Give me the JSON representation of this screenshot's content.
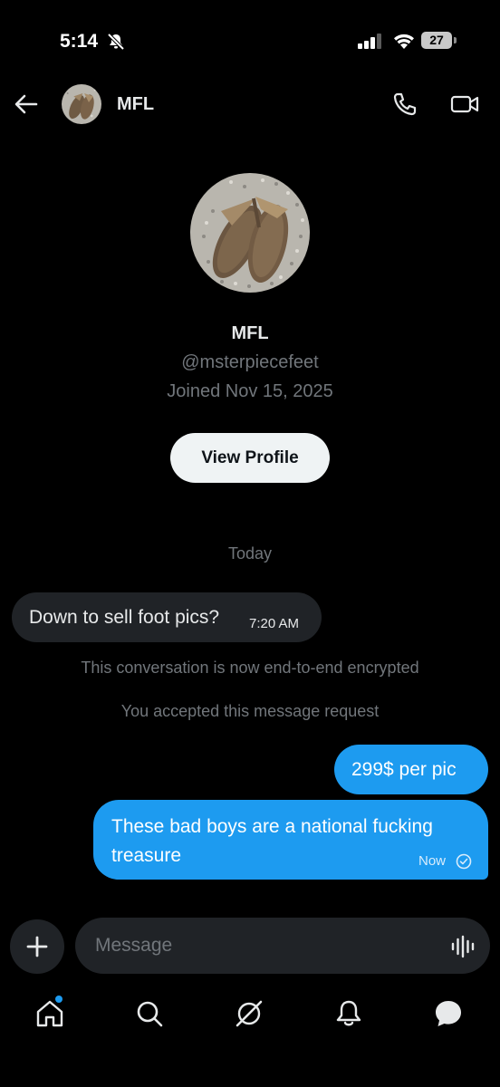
{
  "status_bar": {
    "time": "5:14",
    "battery": "27"
  },
  "header": {
    "name": "MFL"
  },
  "profile": {
    "name": "MFL",
    "handle": "@msterpiecefeet",
    "joined": "Joined Nov 15, 2025",
    "view_profile_label": "View Profile"
  },
  "conversation": {
    "date_label": "Today",
    "incoming": {
      "text": "Down to sell foot pics?",
      "time": "7:20 AM"
    },
    "system_messages": [
      "This conversation is now end-to-end encrypted",
      "You accepted this message request"
    ],
    "outgoing": [
      {
        "text": "299$ per pic"
      },
      {
        "text": "These bad boys are a national fucking treasure",
        "time": "Now"
      }
    ]
  },
  "composer": {
    "placeholder": "Message"
  },
  "bottom_nav": {
    "items": [
      "home",
      "search",
      "grok",
      "notifications",
      "messages"
    ]
  },
  "colors": {
    "accent": "#1d9bf0",
    "background": "#000000",
    "bubble_incoming": "#202327"
  }
}
